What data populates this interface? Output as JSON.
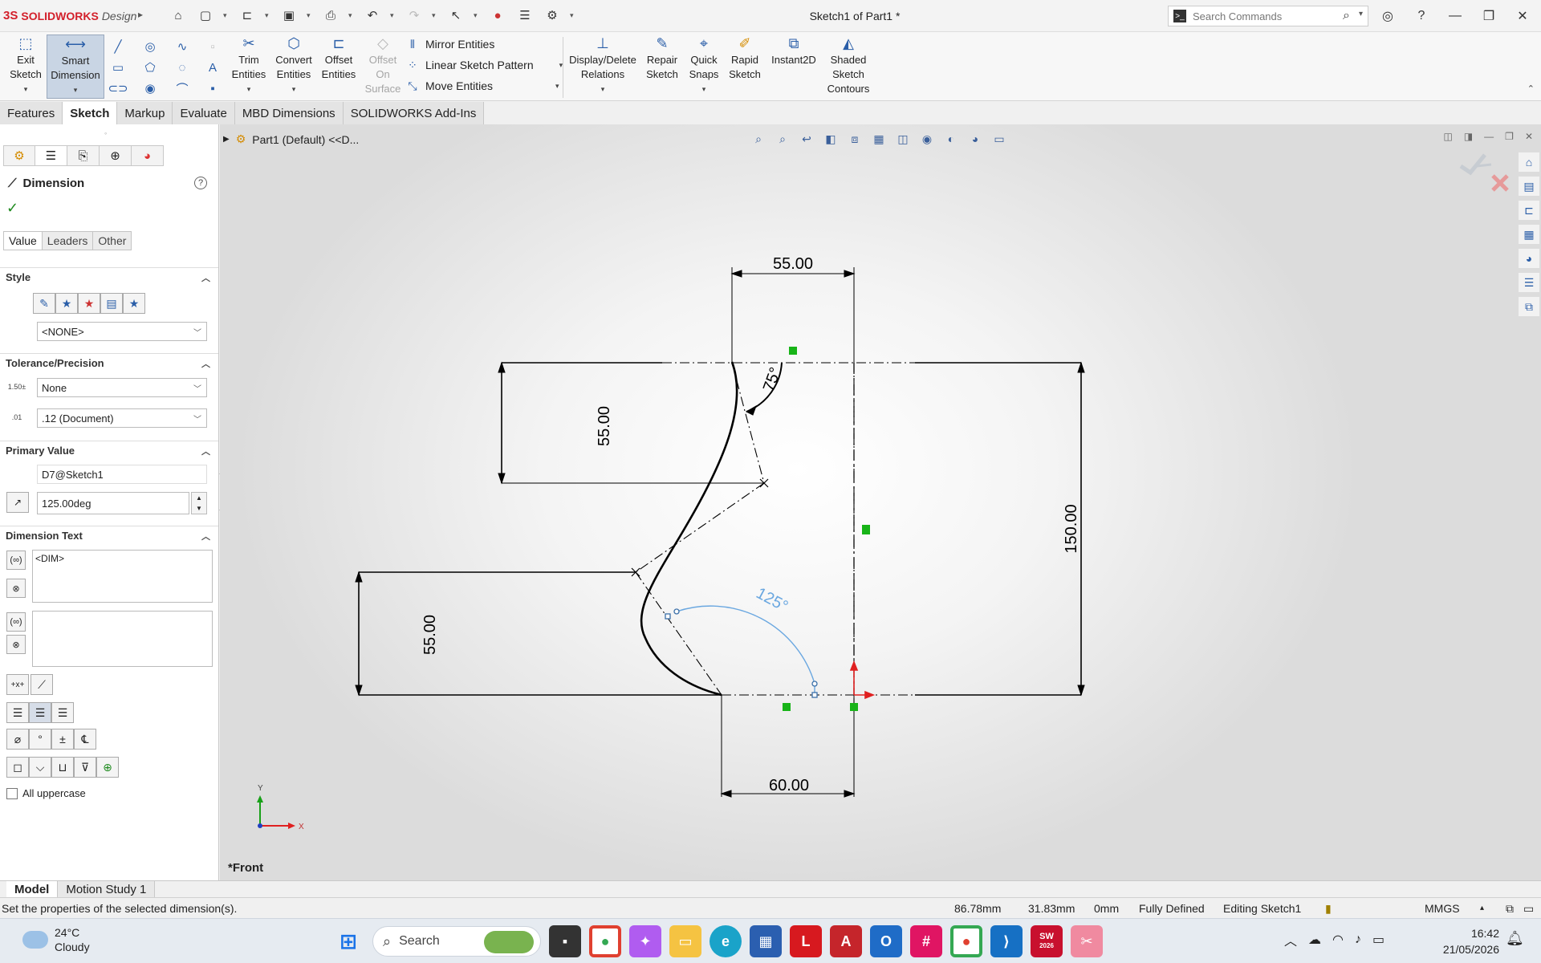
{
  "app": {
    "logo_ds": "3S",
    "logo_brand": "SOLIDWORKS",
    "logo_suffix": "Design",
    "document_title": "Sketch1 of Part1 *",
    "search_placeholder": "Search Commands"
  },
  "command_manager": {
    "exit_sketch": "Exit Sketch",
    "smart_dimension": "Smart Dimension",
    "trim_entities": "Trim Entities",
    "convert_entities": "Convert Entities",
    "offset_entities": "Offset Entities",
    "offset_on_surface": "Offset On Surface",
    "mirror_entities": "Mirror Entities",
    "linear_sketch_pattern": "Linear Sketch Pattern",
    "move_entities": "Move Entities",
    "display_delete_relations": "Display/Delete Relations",
    "repair_sketch": "Repair Sketch",
    "quick_snaps": "Quick Snaps",
    "rapid_sketch": "Rapid Sketch",
    "instant2d": "Instant2D",
    "shaded_sketch_contours": "Shaded Sketch Contours"
  },
  "tabs": [
    "Features",
    "Sketch",
    "Markup",
    "Evaluate",
    "MBD Dimensions",
    "SOLIDWORKS Add-Ins"
  ],
  "active_tab": "Sketch",
  "property_manager": {
    "title": "Dimension",
    "subtabs": [
      "Value",
      "Leaders",
      "Other"
    ],
    "style_label": "Style",
    "style_value": "<NONE>",
    "tolerance_label": "Tolerance/Precision",
    "tolerance_value": "None",
    "precision_value": ".12 (Document)",
    "primary_value_label": "Primary Value",
    "dimension_name": "D7@Sketch1",
    "dimension_value": "125.00deg",
    "dimension_text_label": "Dimension Text",
    "dimension_text": "<DIM>",
    "all_uppercase": "All uppercase"
  },
  "viewport": {
    "tree_root": "Part1  (Default) <<D...",
    "view_name": "*Front"
  },
  "sketch_dims": {
    "top_width": "55.00",
    "top_height": "55.00",
    "overall_height": "150.00",
    "bottom_height": "55.00",
    "bottom_width": "60.00",
    "top_angle": "75°",
    "selected_angle": "125°"
  },
  "axis": {
    "x": "X",
    "y": "Y"
  },
  "model_tabs": [
    "Model",
    "Motion Study 1"
  ],
  "status": {
    "message": "Set the properties of the selected dimension(s).",
    "x_coord": "86.78mm",
    "y_coord": "31.83mm",
    "z_coord": "0mm",
    "state": "Fully Defined",
    "mode": "Editing Sketch1",
    "units": "MMGS"
  },
  "taskbar": {
    "temperature": "24°C",
    "weather": "Cloudy",
    "search": "Search",
    "time": "16:42",
    "date": "21/05/2026",
    "sw_badge": "SW",
    "sw_year": "2026"
  },
  "colors": {
    "selected_dimension": "#6aa7e0",
    "fixed_marker": "#18b418",
    "origin_red": "#e02020"
  }
}
